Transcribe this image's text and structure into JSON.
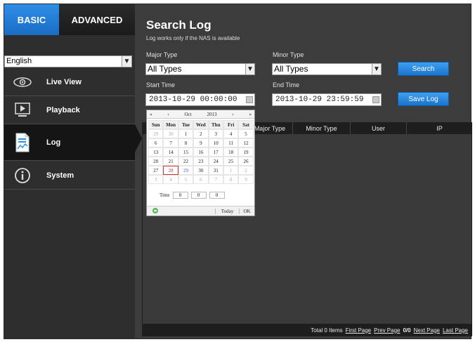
{
  "tabs": {
    "basic": "BASIC",
    "advanced": "ADVANCED"
  },
  "language": {
    "value": "English"
  },
  "nav": [
    {
      "label": "Live View",
      "icon": "eye-icon"
    },
    {
      "label": "Playback",
      "icon": "play-screen-icon"
    },
    {
      "label": "Log",
      "icon": "document-chart-icon"
    },
    {
      "label": "System",
      "icon": "info-icon"
    }
  ],
  "page": {
    "title": "Search Log",
    "subtitle": "Log works only if the NAS is available"
  },
  "form": {
    "major_label": "Major Type",
    "major_value": "All Types",
    "minor_label": "Minor Type",
    "minor_value": "All Types",
    "start_label": "Start Time",
    "start_value": "2013-10-29 00:00:00",
    "end_label": "End Time",
    "end_value": "2013-10-29 23:59:59",
    "search_button": "Search",
    "save_button": "Save Log"
  },
  "table": {
    "columns": [
      "Major Type",
      "Minor Type",
      "User",
      "IP"
    ]
  },
  "pager": {
    "total": "Total 0 Items",
    "first": "First Page",
    "prev": "Prev Page",
    "count": "0/0",
    "next": "Next Page",
    "last": "Last Page"
  },
  "calendar": {
    "prev_year": "«",
    "prev_month": "‹",
    "month": "Oct",
    "year": "2013",
    "next_month": "›",
    "next_year": "»",
    "weekdays": [
      "Sun",
      "Mon",
      "Tue",
      "Wed",
      "Thu",
      "Fri",
      "Sat"
    ],
    "weeks": [
      [
        "29",
        "30",
        "1",
        "2",
        "3",
        "4",
        "5"
      ],
      [
        "6",
        "7",
        "8",
        "9",
        "10",
        "11",
        "12"
      ],
      [
        "13",
        "14",
        "15",
        "16",
        "17",
        "18",
        "19"
      ],
      [
        "20",
        "21",
        "22",
        "23",
        "24",
        "25",
        "26"
      ],
      [
        "27",
        "28",
        "29",
        "30",
        "31",
        "1",
        "2"
      ],
      [
        "3",
        "4",
        "5",
        "6",
        "7",
        "8",
        "9"
      ]
    ],
    "time_label": "Time",
    "hour": "0",
    "minute": "0",
    "second": "0",
    "today_button": "Today",
    "ok_button": "OK"
  }
}
